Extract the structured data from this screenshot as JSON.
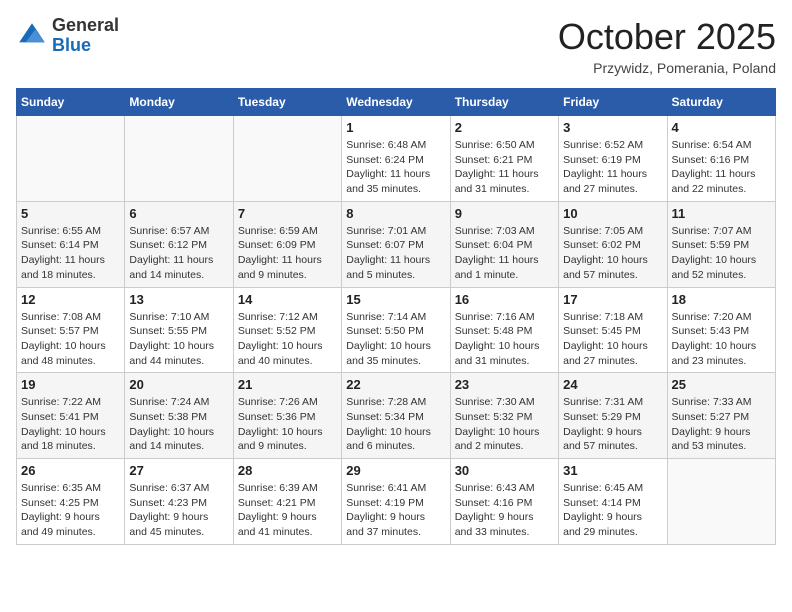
{
  "header": {
    "logo_line1": "General",
    "logo_line2": "Blue",
    "month": "October 2025",
    "location": "Przywidz, Pomerania, Poland"
  },
  "weekdays": [
    "Sunday",
    "Monday",
    "Tuesday",
    "Wednesday",
    "Thursday",
    "Friday",
    "Saturday"
  ],
  "weeks": [
    [
      null,
      null,
      null,
      {
        "day": 1,
        "sunrise": "6:48 AM",
        "sunset": "6:24 PM",
        "daylight": "11 hours and 35 minutes."
      },
      {
        "day": 2,
        "sunrise": "6:50 AM",
        "sunset": "6:21 PM",
        "daylight": "11 hours and 31 minutes."
      },
      {
        "day": 3,
        "sunrise": "6:52 AM",
        "sunset": "6:19 PM",
        "daylight": "11 hours and 27 minutes."
      },
      {
        "day": 4,
        "sunrise": "6:54 AM",
        "sunset": "6:16 PM",
        "daylight": "11 hours and 22 minutes."
      }
    ],
    [
      {
        "day": 5,
        "sunrise": "6:55 AM",
        "sunset": "6:14 PM",
        "daylight": "11 hours and 18 minutes."
      },
      {
        "day": 6,
        "sunrise": "6:57 AM",
        "sunset": "6:12 PM",
        "daylight": "11 hours and 14 minutes."
      },
      {
        "day": 7,
        "sunrise": "6:59 AM",
        "sunset": "6:09 PM",
        "daylight": "11 hours and 9 minutes."
      },
      {
        "day": 8,
        "sunrise": "7:01 AM",
        "sunset": "6:07 PM",
        "daylight": "11 hours and 5 minutes."
      },
      {
        "day": 9,
        "sunrise": "7:03 AM",
        "sunset": "6:04 PM",
        "daylight": "11 hours and 1 minute."
      },
      {
        "day": 10,
        "sunrise": "7:05 AM",
        "sunset": "6:02 PM",
        "daylight": "10 hours and 57 minutes."
      },
      {
        "day": 11,
        "sunrise": "7:07 AM",
        "sunset": "5:59 PM",
        "daylight": "10 hours and 52 minutes."
      }
    ],
    [
      {
        "day": 12,
        "sunrise": "7:08 AM",
        "sunset": "5:57 PM",
        "daylight": "10 hours and 48 minutes."
      },
      {
        "day": 13,
        "sunrise": "7:10 AM",
        "sunset": "5:55 PM",
        "daylight": "10 hours and 44 minutes."
      },
      {
        "day": 14,
        "sunrise": "7:12 AM",
        "sunset": "5:52 PM",
        "daylight": "10 hours and 40 minutes."
      },
      {
        "day": 15,
        "sunrise": "7:14 AM",
        "sunset": "5:50 PM",
        "daylight": "10 hours and 35 minutes."
      },
      {
        "day": 16,
        "sunrise": "7:16 AM",
        "sunset": "5:48 PM",
        "daylight": "10 hours and 31 minutes."
      },
      {
        "day": 17,
        "sunrise": "7:18 AM",
        "sunset": "5:45 PM",
        "daylight": "10 hours and 27 minutes."
      },
      {
        "day": 18,
        "sunrise": "7:20 AM",
        "sunset": "5:43 PM",
        "daylight": "10 hours and 23 minutes."
      }
    ],
    [
      {
        "day": 19,
        "sunrise": "7:22 AM",
        "sunset": "5:41 PM",
        "daylight": "10 hours and 18 minutes."
      },
      {
        "day": 20,
        "sunrise": "7:24 AM",
        "sunset": "5:38 PM",
        "daylight": "10 hours and 14 minutes."
      },
      {
        "day": 21,
        "sunrise": "7:26 AM",
        "sunset": "5:36 PM",
        "daylight": "10 hours and 9 minutes."
      },
      {
        "day": 22,
        "sunrise": "7:28 AM",
        "sunset": "5:34 PM",
        "daylight": "10 hours and 6 minutes."
      },
      {
        "day": 23,
        "sunrise": "7:30 AM",
        "sunset": "5:32 PM",
        "daylight": "10 hours and 2 minutes."
      },
      {
        "day": 24,
        "sunrise": "7:31 AM",
        "sunset": "5:29 PM",
        "daylight": "9 hours and 57 minutes."
      },
      {
        "day": 25,
        "sunrise": "7:33 AM",
        "sunset": "5:27 PM",
        "daylight": "9 hours and 53 minutes."
      }
    ],
    [
      {
        "day": 26,
        "sunrise": "6:35 AM",
        "sunset": "4:25 PM",
        "daylight": "9 hours and 49 minutes."
      },
      {
        "day": 27,
        "sunrise": "6:37 AM",
        "sunset": "4:23 PM",
        "daylight": "9 hours and 45 minutes."
      },
      {
        "day": 28,
        "sunrise": "6:39 AM",
        "sunset": "4:21 PM",
        "daylight": "9 hours and 41 minutes."
      },
      {
        "day": 29,
        "sunrise": "6:41 AM",
        "sunset": "4:19 PM",
        "daylight": "9 hours and 37 minutes."
      },
      {
        "day": 30,
        "sunrise": "6:43 AM",
        "sunset": "4:16 PM",
        "daylight": "9 hours and 33 minutes."
      },
      {
        "day": 31,
        "sunrise": "6:45 AM",
        "sunset": "4:14 PM",
        "daylight": "9 hours and 29 minutes."
      },
      null
    ]
  ],
  "labels": {
    "sunrise": "Sunrise:",
    "sunset": "Sunset:",
    "daylight": "Daylight hours"
  }
}
